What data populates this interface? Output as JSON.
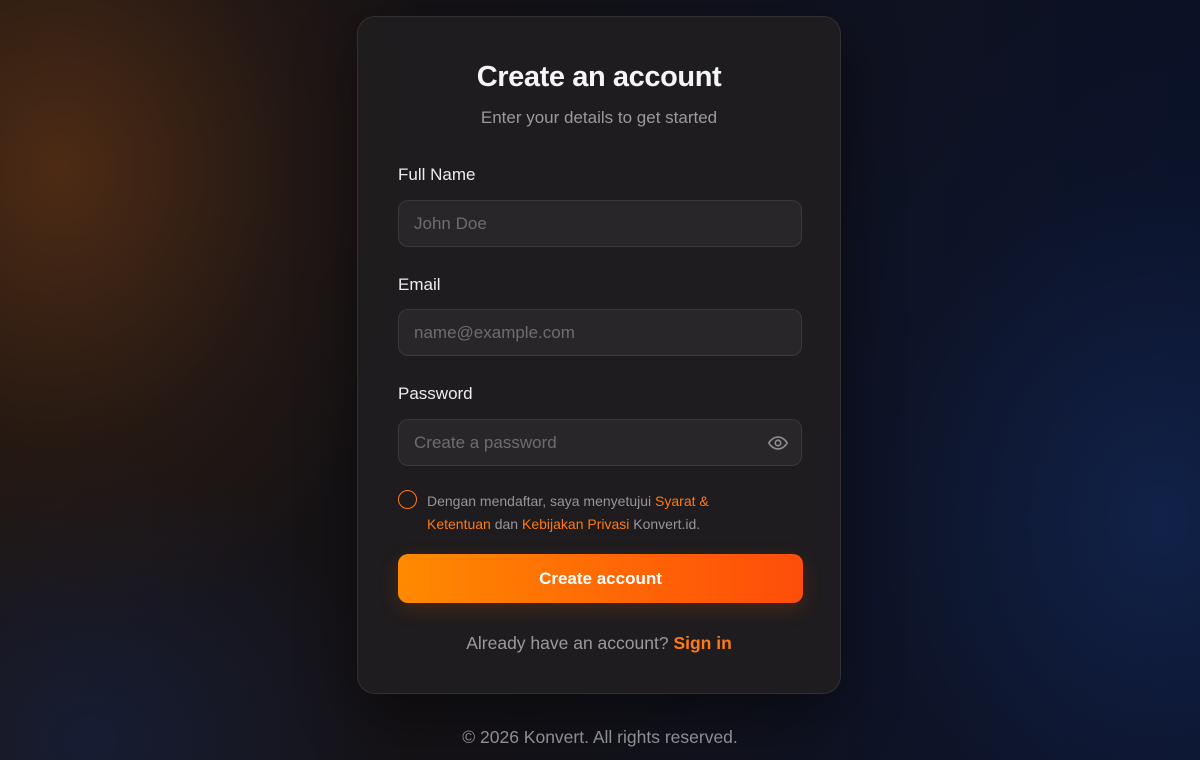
{
  "card": {
    "title": "Create an account",
    "subtitle": "Enter your details to get started"
  },
  "form": {
    "full_name": {
      "label": "Full Name",
      "placeholder": "John Doe",
      "value": ""
    },
    "email": {
      "label": "Email",
      "placeholder": "name@example.com",
      "value": ""
    },
    "password": {
      "label": "Password",
      "placeholder": "Create a password",
      "value": "",
      "toggle_icon": "eye-icon"
    },
    "terms": {
      "checked": false,
      "prefix": "Dengan mendaftar, saya menyetujui ",
      "link1": "Syarat & Ketentuan",
      "middle": " dan ",
      "link2": "Kebijakan Privasi",
      "suffix": " Konvert.id."
    },
    "submit_label": "Create account"
  },
  "signin": {
    "prompt": "Already have an account? ",
    "link": "Sign in"
  },
  "footer": {
    "text": "© 2026 Konvert. All rights reserved."
  },
  "colors": {
    "accent": "#ff7a12",
    "button_start": "#ff8a00",
    "button_end": "#ff4d0a",
    "card_bg": "#201d1f",
    "input_bg": "#29262a"
  }
}
